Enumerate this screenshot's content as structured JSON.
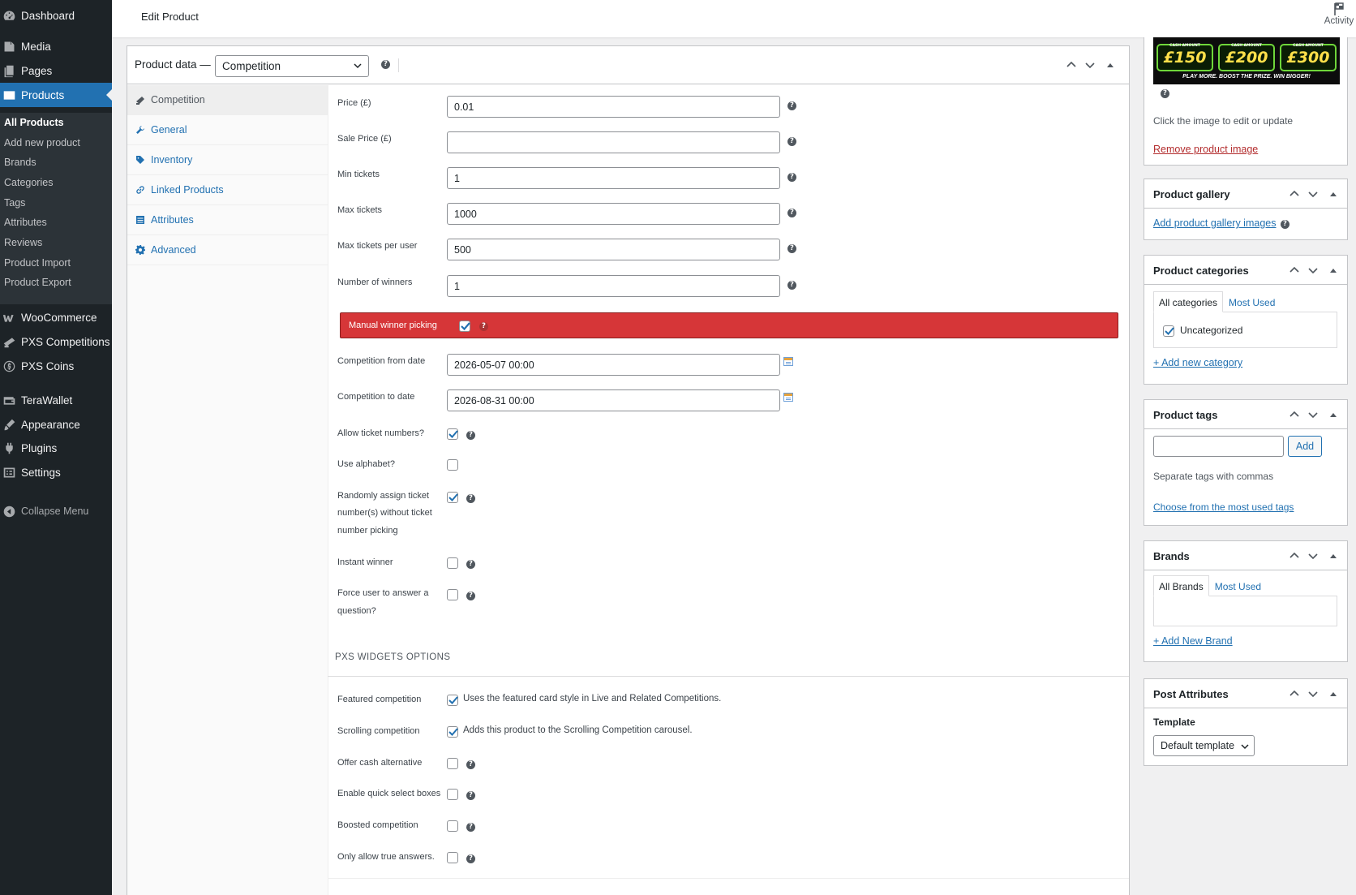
{
  "sidebar": {
    "items": [
      {
        "label": "Dashboard",
        "icon": "dashboard-icon"
      },
      {
        "label": "Media",
        "icon": "media-icon"
      },
      {
        "label": "Pages",
        "icon": "pages-icon"
      },
      {
        "label": "Products",
        "icon": "products-icon",
        "active": true
      },
      {
        "label": "WooCommerce",
        "icon": "woocommerce-icon"
      },
      {
        "label": "PXS Competitions",
        "icon": "pxs-competitions-icon"
      },
      {
        "label": "PXS Coins",
        "icon": "coins-icon"
      },
      {
        "label": "TeraWallet",
        "icon": "wallet-icon"
      },
      {
        "label": "Appearance",
        "icon": "appearance-icon"
      },
      {
        "label": "Plugins",
        "icon": "plugins-icon"
      },
      {
        "label": "Settings",
        "icon": "settings-icon"
      }
    ],
    "submenu": [
      "All Products",
      "Add new product",
      "Brands",
      "Categories",
      "Tags",
      "Attributes",
      "Reviews",
      "Product Import",
      "Product Export"
    ],
    "collapse_label": "Collapse Menu"
  },
  "header": {
    "title": "Edit Product",
    "activity_label": "Activity"
  },
  "product_data": {
    "title": "Product data —",
    "type_selected": "Competition",
    "tabs": [
      "Competition",
      "General",
      "Inventory",
      "Linked Products",
      "Attributes",
      "Advanced"
    ],
    "fields": {
      "price_label": "Price (£)",
      "price_value": "0.01",
      "sale_price_label": "Sale Price (£)",
      "sale_price_value": "",
      "min_tickets_label": "Min tickets",
      "min_tickets_value": "1",
      "max_tickets_label": "Max tickets",
      "max_tickets_value": "1000",
      "max_per_user_label": "Max tickets per user",
      "max_per_user_value": "500",
      "winners_label": "Number of winners",
      "winners_value": "1",
      "manual_winner_label": "Manual winner picking",
      "from_date_label": "Competition from date",
      "from_date_value": "2026-05-07 00:00",
      "to_date_label": "Competition to date",
      "to_date_value": "2026-08-31 00:00",
      "allow_ticket_numbers_label": "Allow ticket numbers?",
      "use_alphabet_label": "Use alphabet?",
      "random_assign_label_1": "Randomly assign ticket",
      "random_assign_label_2": "number(s) without ticket",
      "random_assign_label_3": "number picking",
      "instant_winner_label": "Instant winner",
      "force_question_label_1": "Force user to answer a",
      "force_question_label_2": "question?"
    },
    "widgets": {
      "heading": "PXS WIDGETS OPTIONS",
      "featured_label": "Featured competition",
      "featured_desc": "Uses the featured card style in Live and Related Competitions.",
      "scrolling_label": "Scrolling competition",
      "scrolling_desc": "Adds this product to the Scrolling Competition carousel.",
      "cash_alt_label": "Offer cash alternative",
      "quick_select_label": "Enable quick select boxes",
      "boosted_label": "Boosted competition",
      "true_answers_label": "Only allow true answers."
    }
  },
  "right": {
    "product_image": {
      "banner": {
        "labels": [
          "CASH AMOUNT",
          "CASH AMOUNT",
          "CASH AMOUNT"
        ],
        "amounts": [
          "£150",
          "£200",
          "£300"
        ],
        "tagline": "PLAY MORE. BOOST THE PRIZE. WIN BIGGER!"
      },
      "hint": "Click the image to edit or update",
      "remove_link": "Remove product image"
    },
    "gallery": {
      "title": "Product gallery",
      "link": "Add product gallery images"
    },
    "categories": {
      "title": "Product categories",
      "tab_all": "All categories",
      "tab_most": "Most Used",
      "item": "Uncategorized",
      "add_link": "+ Add new category"
    },
    "tags": {
      "title": "Product tags",
      "add_button": "Add",
      "hint": "Separate tags with commas",
      "choose_link": "Choose from the most used tags"
    },
    "brands": {
      "title": "Brands",
      "tab_all": "All Brands",
      "tab_most": "Most Used",
      "add_link": "+ Add New Brand"
    },
    "post_attributes": {
      "title": "Post Attributes",
      "template_label": "Template",
      "template_value": "Default template"
    }
  },
  "colors": {
    "accent": "#2271b1",
    "sidebar": "#1d2327",
    "alert": "#d63638"
  }
}
